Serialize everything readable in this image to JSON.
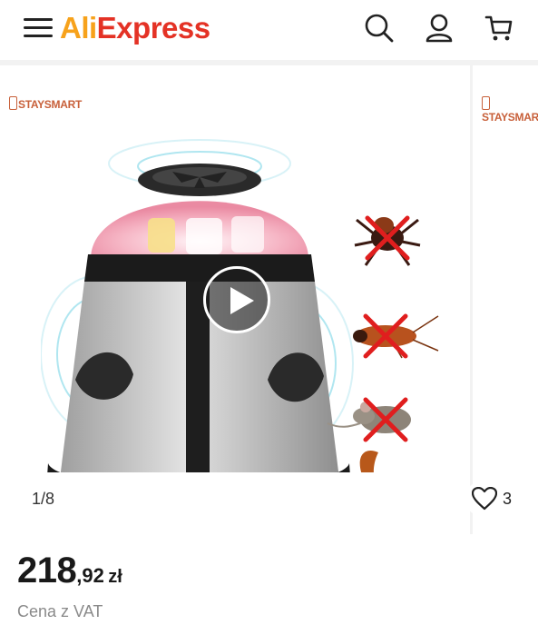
{
  "header": {
    "logo_part1": "Ali",
    "logo_part2": "Express",
    "icons": [
      "menu-icon",
      "search-icon",
      "user-icon",
      "cart-icon"
    ]
  },
  "gallery": {
    "brand": "STAYSMART",
    "brand_next": "STAYSMART",
    "counter": "1/8",
    "favorites_count": "3",
    "pests": [
      "spider",
      "cockroach",
      "mouse",
      "squirrel"
    ]
  },
  "price": {
    "integer": "218",
    "decimal": ",92",
    "currency": "zł",
    "vat_note": "Cena z VAT"
  },
  "colors": {
    "ali": "#f7a21b",
    "express": "#e43225",
    "brand": "#c8603a"
  }
}
